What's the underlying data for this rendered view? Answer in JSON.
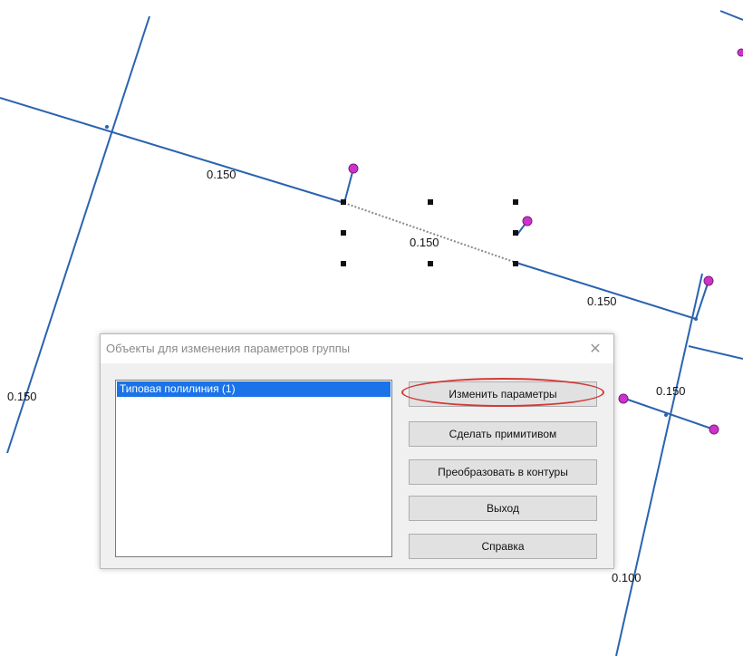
{
  "canvas": {
    "labels": [
      "0.150",
      "0.150",
      "0.150",
      "0.150",
      "0.150",
      "0.100"
    ],
    "line_color": "#2a63b0",
    "vertex_color": "#cc33cc",
    "selection_color": "#111111"
  },
  "dialog": {
    "title": "Объекты для изменения параметров группы",
    "close_glyph": "✕",
    "list_items": [
      "Типовая полилиния (1)"
    ],
    "buttons": {
      "change_params": "Изменить параметры",
      "make_primitive": "Сделать примитивом",
      "convert_contours": "Преобразовать в контуры",
      "exit": "Выход",
      "help": "Справка"
    },
    "highlight_color": "#d23a3a"
  }
}
